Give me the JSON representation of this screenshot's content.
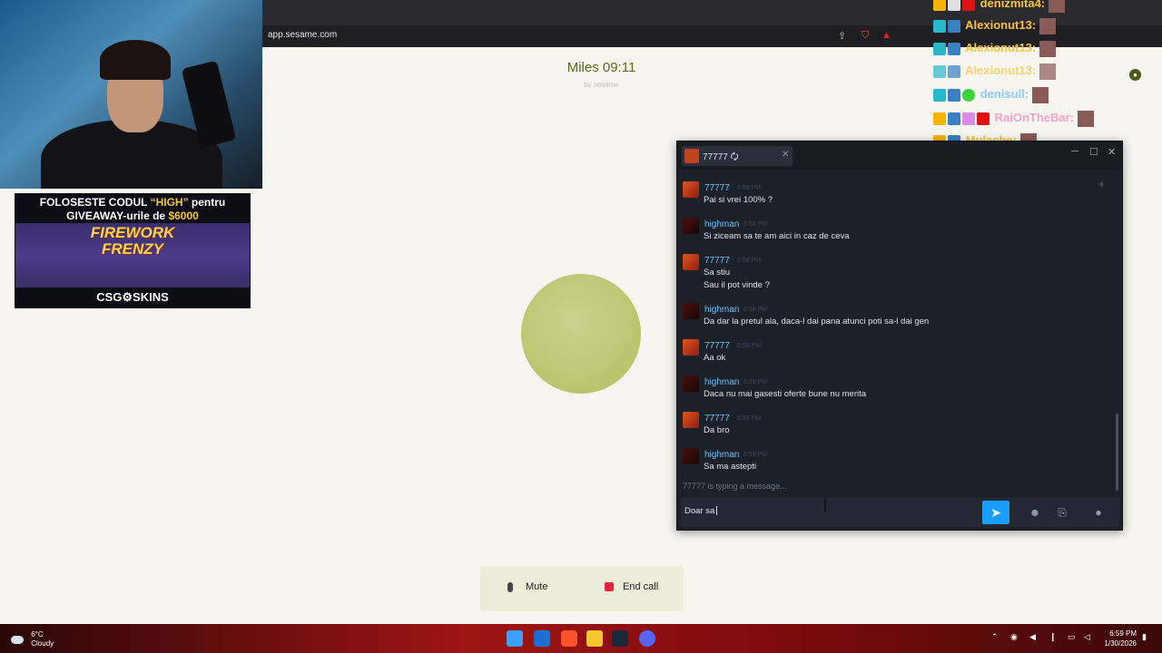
{
  "browser": {
    "url": "app.sesame.com"
  },
  "page": {
    "title": "Miles 09:11",
    "subtitle": "by sesame"
  },
  "call_controls": {
    "mute_label": "Mute",
    "end_label": "End call"
  },
  "stream_overlay": {
    "promo_line1_a": "FOLOSESTE CODUL ",
    "promo_code": "“HIGH”",
    "promo_line1_b": " pentru",
    "promo_line2_a": "GIVEAWAY-urile de ",
    "promo_amount": "$6000",
    "promo_game_1": "FIREWORK",
    "promo_game_2": "FRENZY",
    "promo_brand": "CSG⚙SKINS",
    "chat": [
      {
        "user": "denizmita4:",
        "color": "#f9c23c"
      },
      {
        "user": "Alexionut13:",
        "color": "#f9c23c"
      },
      {
        "user": "Alexionut13:",
        "color": "#f9c23c"
      },
      {
        "user": "Alexionut13:",
        "color": "#f9c23c"
      },
      {
        "user": "denisull:",
        "color": "#8ec9ff"
      },
      {
        "user": "RaiOnTheBar:",
        "color": "#f7a2c8"
      },
      {
        "user": "Mulache:",
        "color": "#f9c23c"
      }
    ]
  },
  "steam_chat": {
    "tab_name": "77777 🗘",
    "messages": [
      {
        "user": "77777",
        "time": "6:58 PM",
        "lines": [
          "Pai si vrei 100% ?"
        ],
        "avatar": "a"
      },
      {
        "user": "highman",
        "time": "6:58 PM",
        "lines": [
          "Si ziceam sa te am aici in caz de ceva"
        ],
        "avatar": "b"
      },
      {
        "user": "77777",
        "time": "6:58 PM",
        "lines": [
          "Sa stiu",
          "Sau il pot vinde ?"
        ],
        "avatar": "a"
      },
      {
        "user": "highman",
        "time": "6:58 PM",
        "lines": [
          "Da dar la pretul ala, daca-l dai pana atunci poti sa-l dai gen"
        ],
        "avatar": "b"
      },
      {
        "user": "77777",
        "time": "6:58 PM",
        "lines": [
          "Aa ok"
        ],
        "avatar": "a"
      },
      {
        "user": "highman",
        "time": "6:59 PM",
        "lines": [
          "Daca nu mai gasesti oferte bune nu merita"
        ],
        "avatar": "b"
      },
      {
        "user": "77777",
        "time": "6:59 PM",
        "lines": [
          "Da bro"
        ],
        "avatar": "a"
      },
      {
        "user": "highman",
        "time": "6:59 PM",
        "lines": [
          "Sa ma astepti"
        ],
        "avatar": "b"
      }
    ],
    "typing_indicator": "77777 is typing a message...",
    "input_value": "Doar sa"
  },
  "taskbar": {
    "temperature": "6°C",
    "condition": "Cloudy",
    "time": "6:59 PM",
    "date": "1/30/2026"
  }
}
